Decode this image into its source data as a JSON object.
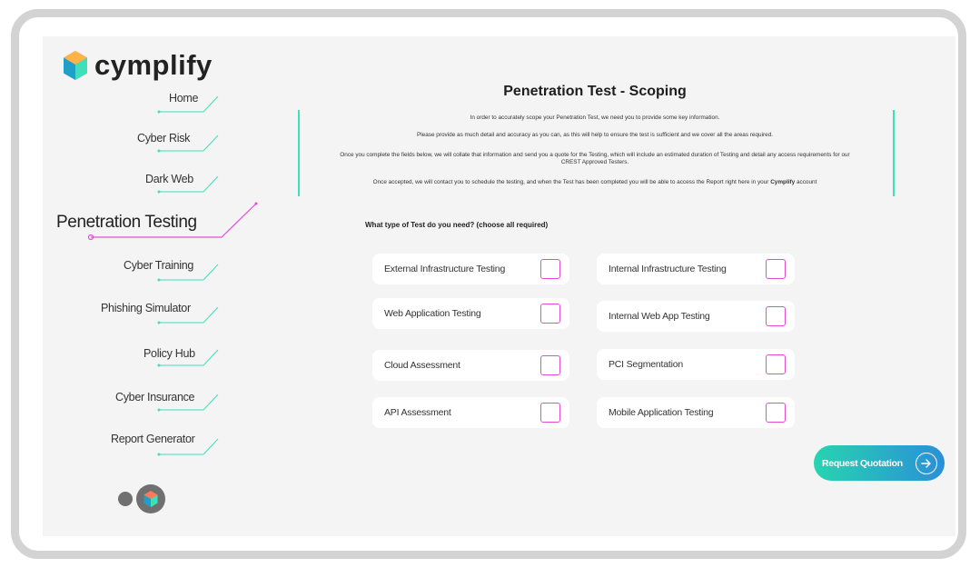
{
  "brand": {
    "name": "cymplify",
    "accent": "#3de0b8",
    "active_color": "#e34dd2"
  },
  "sidebar": {
    "items": [
      {
        "label": "Home"
      },
      {
        "label": "Cyber Risk"
      },
      {
        "label": "Dark Web"
      },
      {
        "label": "Penetration Testing",
        "active": true
      },
      {
        "label": "Cyber Training"
      },
      {
        "label": "Phishing Simulator"
      },
      {
        "label": "Policy Hub"
      },
      {
        "label": "Cyber Insurance"
      },
      {
        "label": "Report Generator"
      }
    ]
  },
  "main": {
    "title": "Penetration Test - Scoping",
    "intro": {
      "line1": "In order to accurately scope your Penetration Test, we need you to provide some key information.",
      "line2": "Please provide as much detail and accuracy as you can, as this will help to ensure the test is sufficient and we cover all the areas required.",
      "line3": "Once you complete the fields below, we will collate that information and send you a quote for the Testing, which will include an estimated duration of Testing and detail any access requirements for our CREST Approved Testers.",
      "line4_part1": "Once accepted, we will contact you to schedule the testing, and when the Test has been completed you will be able to access the Report right here in your",
      "line4_brand": "Cymplify",
      "line4_part2": "account"
    },
    "question": "What type of Test do you need? (choose all required)",
    "options": [
      {
        "label": "External Infrastructure Testing",
        "checked": false
      },
      {
        "label": "Internal Infrastructure Testing",
        "checked": false
      },
      {
        "label": "Web Application Testing",
        "checked": false
      },
      {
        "label": "Internal Web App Testing",
        "checked": false
      },
      {
        "label": "Cloud Assessment",
        "checked": false
      },
      {
        "label": "PCI Segmentation",
        "checked": false
      },
      {
        "label": "API Assessment",
        "checked": false
      },
      {
        "label": "Mobile Application Testing",
        "checked": false
      }
    ],
    "submit_label": "Request Quotation"
  }
}
